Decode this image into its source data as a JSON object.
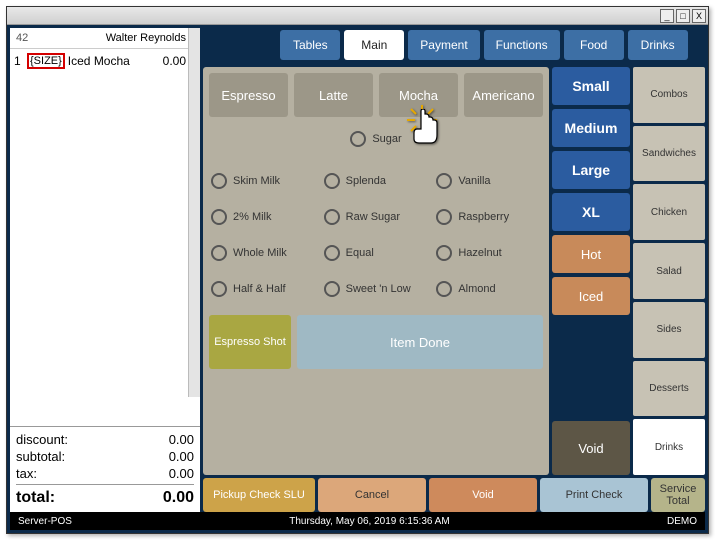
{
  "titlebar": {
    "min": "_",
    "max": "□",
    "close": "X"
  },
  "check": {
    "number": "42",
    "server": "Walter Reynolds",
    "items": [
      {
        "qty": "1",
        "size_placeholder": "{SIZE}",
        "name": "Iced Mocha",
        "price": "0.00"
      }
    ],
    "discount_label": "discount:",
    "discount": "0.00",
    "subtotal_label": "subtotal:",
    "subtotal": "0.00",
    "tax_label": "tax:",
    "tax": "0.00",
    "total_label": "total:",
    "total": "0.00"
  },
  "nav": [
    "Tables",
    "Main",
    "Payment",
    "Functions",
    "Food",
    "Drinks"
  ],
  "nav_active": 1,
  "drinks": [
    "Espresso",
    "Latte",
    "Mocha",
    "Americano"
  ],
  "mods_top": [
    "Sugar"
  ],
  "mods": [
    "Skim Milk",
    "Splenda",
    "Vanilla",
    "2% Milk",
    "Raw Sugar",
    "Raspberry",
    "Whole Milk",
    "Equal",
    "Hazelnut",
    "Half & Half",
    "Sweet 'n Low",
    "Almond"
  ],
  "actions": {
    "espresso_shot": "Espresso Shot",
    "item_done": "Item Done"
  },
  "sizes": [
    "Small",
    "Medium",
    "Large",
    "XL"
  ],
  "temps": [
    "Hot",
    "Iced"
  ],
  "voidlbl": "Void",
  "cats": [
    "Combos",
    "Sandwiches",
    "Chicken",
    "Salad",
    "Sides",
    "Desserts",
    "Drinks"
  ],
  "cats_active": 6,
  "bottom": {
    "pickup": "Pickup Check SLU",
    "cancel": "Cancel",
    "void": "Void",
    "print": "Print Check",
    "service": "Service Total"
  },
  "status": {
    "left": "Server-POS",
    "center": "Thursday, May 06, 2019 6:15:36 AM",
    "right": "DEMO"
  }
}
